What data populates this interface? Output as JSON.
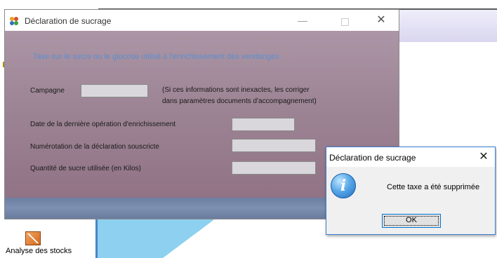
{
  "window": {
    "title": "Déclaration de sucrage",
    "subtitle": "Taxe sur le sucre ou le glucose utilisé à l'enrichissement des vendanges",
    "campagne_label": "Campagne",
    "campagne_value": "",
    "note_line1": "(Si ces informations sont inexactes, les corriger",
    "note_line2": "dans paramètres documents d'accompagnement)",
    "date_label": "Date de la dernière opération d'enrichissement",
    "date_value": "",
    "numero_label": "Numérotation de la déclaration souscricte",
    "numero_value": "",
    "quantite_label": "Quantité de sucre utilisée (en Kilos)",
    "quantite_value": "",
    "minimize_glyph": "—",
    "close_glyph": "✕"
  },
  "dialog": {
    "title": "Déclaration de sucrage",
    "message": "Cette taxe a été supprimée",
    "ok_label": "OK",
    "icon": "i",
    "close_glyph": "✕"
  },
  "desktop": {
    "icon_label": "Analyse des stocks"
  },
  "colors": {
    "subtitle": "#5b8fcf",
    "window_bg": "#9d8595",
    "footer": "#7d90b2",
    "dialog_border": "#3c7fd0"
  }
}
